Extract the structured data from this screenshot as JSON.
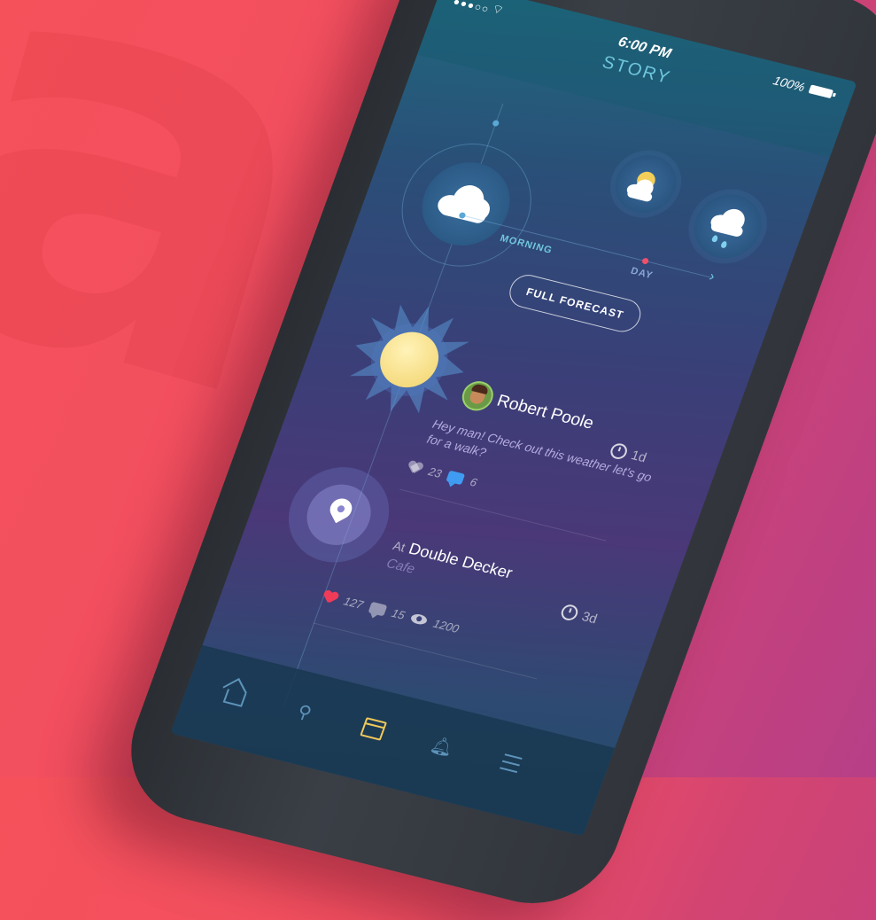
{
  "status_bar": {
    "signal": "●●●○○",
    "time": "6:00 PM",
    "battery": "100%"
  },
  "header": {
    "title": "STORY"
  },
  "weather": {
    "periods": [
      "MORNING",
      "DAY"
    ],
    "forecast_button": "FULL FORECAST",
    "icons": [
      "cloud-icon",
      "partly-sunny-icon",
      "rain-cloud-icon",
      "sun-icon"
    ]
  },
  "feed": [
    {
      "author": "Robert Poole",
      "time": "1d",
      "text": "Hey man! Check out this weather let's go for a walk?",
      "likes": "23",
      "comments": "6"
    },
    {
      "prefix": "At",
      "place": "Double Decker",
      "subtitle": "Cafe",
      "time": "3d",
      "likes": "127",
      "comments": "15",
      "views": "1200"
    }
  ],
  "tabbar": {
    "tabs": [
      "home",
      "search",
      "calendar",
      "notifications",
      "menu"
    ],
    "active": "calendar"
  },
  "colors": {
    "accent": "#6fc6dc",
    "like_red": "#ef3b58",
    "comment_blue": "#3f9cf2",
    "active_tab": "#f2c95a"
  }
}
